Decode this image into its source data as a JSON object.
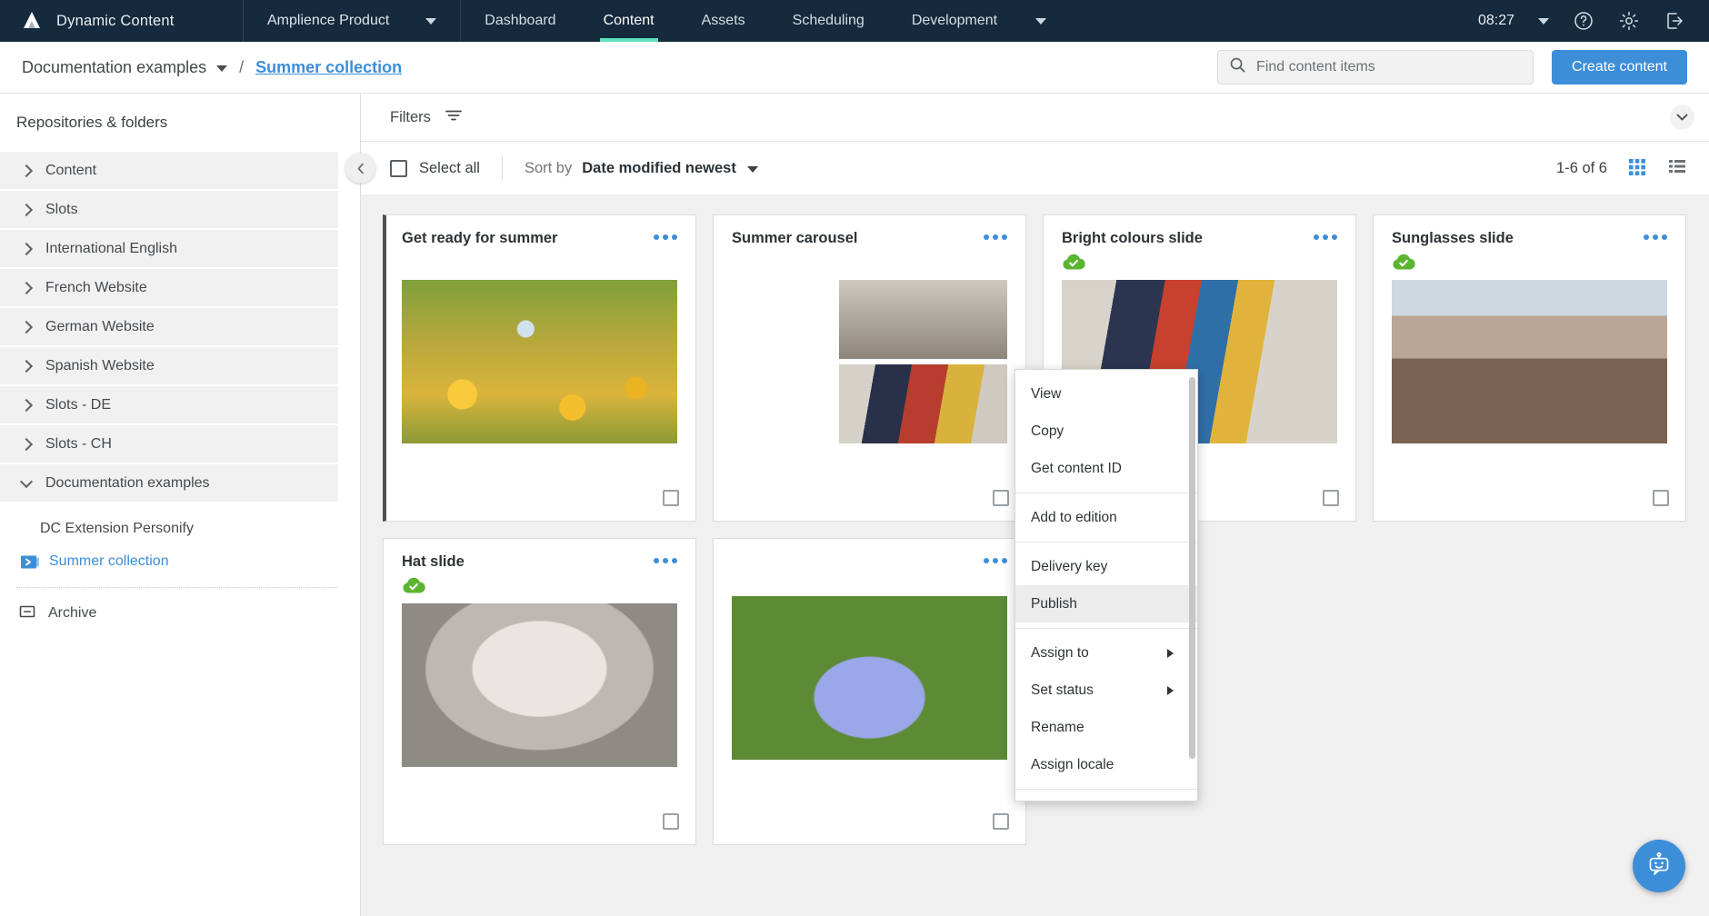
{
  "topnav": {
    "logo_icon": "amplience-logo-icon",
    "brand": "Dynamic Content",
    "product": "Amplience Product",
    "product_caret_icon": "chevron-down-icon",
    "items": [
      {
        "label": "Dashboard",
        "active": false
      },
      {
        "label": "Content",
        "active": true
      },
      {
        "label": "Assets",
        "active": false
      },
      {
        "label": "Scheduling",
        "active": false
      },
      {
        "label": "Development",
        "active": false
      }
    ],
    "more_icon": "chevron-down-icon",
    "time": "08:27",
    "time_caret_icon": "chevron-down-icon",
    "help_icon": "help-circle-icon",
    "settings_icon": "gear-icon",
    "logout_icon": "logout-icon",
    "active_underline_color": "#62e0bd",
    "background_color": "#152a3c"
  },
  "breadcrumb": {
    "root": "Documentation examples",
    "root_caret_icon": "chevron-down-icon",
    "separator": "/",
    "current": "Summer collection",
    "link_color": "#3d8ed9"
  },
  "search": {
    "icon": "search-icon",
    "placeholder": "Find content items",
    "value": ""
  },
  "actions": {
    "create_content": "Create content"
  },
  "sidebar": {
    "title": "Repositories & folders",
    "items": [
      {
        "label": "Content",
        "expanded": false
      },
      {
        "label": "Slots",
        "expanded": false
      },
      {
        "label": "International English",
        "expanded": false
      },
      {
        "label": "French Website",
        "expanded": false
      },
      {
        "label": "German Website",
        "expanded": false
      },
      {
        "label": "Spanish Website",
        "expanded": false
      },
      {
        "label": "Slots - DE",
        "expanded": false
      },
      {
        "label": "Slots - CH",
        "expanded": false
      },
      {
        "label": "Documentation examples",
        "expanded": true
      }
    ],
    "children": [
      {
        "label": "DC Extension Personify",
        "selected": false,
        "icon": "none"
      },
      {
        "label": "Summer collection",
        "selected": true,
        "icon": "folder-open-icon"
      }
    ],
    "archive": {
      "label": "Archive",
      "icon": "archive-box-icon"
    }
  },
  "filterbar": {
    "label": "Filters",
    "icon": "filter-icon",
    "collapse_panel_icon": "chevron-down-icon"
  },
  "sortbar": {
    "collapse_sidebar_icon": "chevron-left-icon",
    "select_all": "Select all",
    "select_all_checked": false,
    "sort_by_label": "Sort by",
    "sort_by_value": "Date modified newest",
    "sort_caret_icon": "chevron-down-icon",
    "count": "1-6 of 6",
    "grid_view_icon": "grid-view-icon",
    "list_view_icon": "list-view-icon",
    "active_view": "grid",
    "active_view_color": "#3d8ed9"
  },
  "cards": [
    {
      "title": "Get ready for summer",
      "status": "",
      "active": true,
      "menu_icon": "more-options-icon",
      "image": "ph-sunflower",
      "checked": false
    },
    {
      "title": "Summer carousel",
      "status": "",
      "active": false,
      "menu_icon": "more-options-icon",
      "image": "carousel",
      "checked": false
    },
    {
      "title": "Bright colours slide",
      "status": "published",
      "active": false,
      "menu_icon": "more-options-icon",
      "image": "ph-colour",
      "checked": false
    },
    {
      "title": "Sunglasses slide",
      "status": "published",
      "active": false,
      "menu_icon": "more-options-icon",
      "image": "ph-sun-glasses",
      "checked": false
    },
    {
      "title": "Hat slide",
      "status": "published",
      "active": false,
      "menu_icon": "more-options-icon",
      "image": "ph-hat-bw",
      "checked": false
    },
    {
      "title": "",
      "status": "",
      "active": false,
      "menu_icon": "more-options-icon",
      "image": "ph-blue-dress",
      "checked": false
    }
  ],
  "status_icon": {
    "name": "published-cloud-icon",
    "color": "#5cb531"
  },
  "context_menu": {
    "groups": [
      {
        "items": [
          {
            "label": "View",
            "submenu": false,
            "highlighted": false
          },
          {
            "label": "Copy",
            "submenu": false,
            "highlighted": false
          },
          {
            "label": "Get content ID",
            "submenu": false,
            "highlighted": false
          }
        ]
      },
      {
        "items": [
          {
            "label": "Add to edition",
            "submenu": false,
            "highlighted": false
          }
        ]
      },
      {
        "items": [
          {
            "label": "Delivery key",
            "submenu": false,
            "highlighted": false
          },
          {
            "label": "Publish",
            "submenu": false,
            "highlighted": true
          }
        ]
      },
      {
        "items": [
          {
            "label": "Assign to",
            "submenu": true,
            "highlighted": false
          },
          {
            "label": "Set status",
            "submenu": true,
            "highlighted": false
          },
          {
            "label": "Rename",
            "submenu": false,
            "highlighted": false
          },
          {
            "label": "Assign locale",
            "submenu": false,
            "highlighted": false
          }
        ]
      }
    ]
  },
  "fab": {
    "icon": "chatbot-icon",
    "color": "#3d8ed9"
  }
}
